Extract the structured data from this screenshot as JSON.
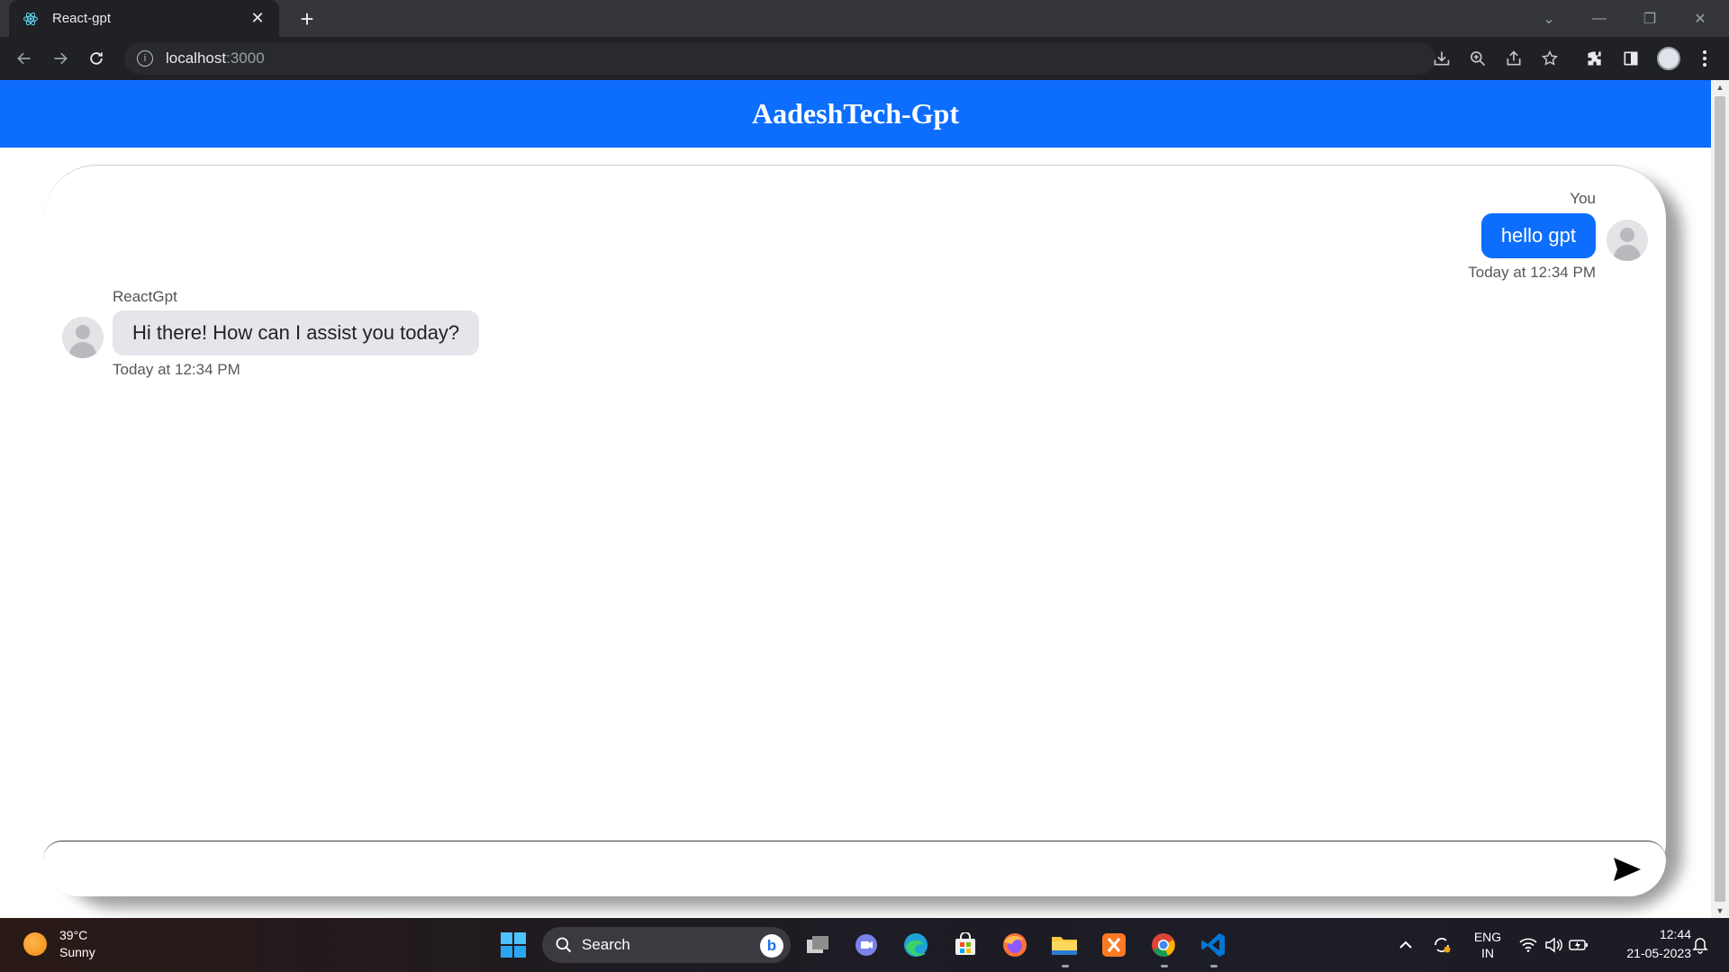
{
  "browser": {
    "tab_title": "React-gpt",
    "url_host": "localhost",
    "url_port": ":3000"
  },
  "app": {
    "header_title": "AadeshTech-Gpt"
  },
  "chat": {
    "messages": [
      {
        "sender": "You",
        "text": "hello gpt",
        "time": "Today at 12:34 PM",
        "direction": "outgoing"
      },
      {
        "sender": "ReactGpt",
        "text": "Hi there! How can I assist you today?",
        "time": "Today at 12:34 PM",
        "direction": "incoming"
      }
    ],
    "input_value": "",
    "colors": {
      "header": "#0d6efd",
      "outgoing_bubble": "#0d6efd",
      "incoming_bubble": "#e4e6eb"
    }
  },
  "taskbar": {
    "weather_temp": "39°C",
    "weather_cond": "Sunny",
    "search_label": "Search",
    "lang_line1": "ENG",
    "lang_line2": "IN",
    "time": "12:44",
    "date": "21-05-2023"
  }
}
